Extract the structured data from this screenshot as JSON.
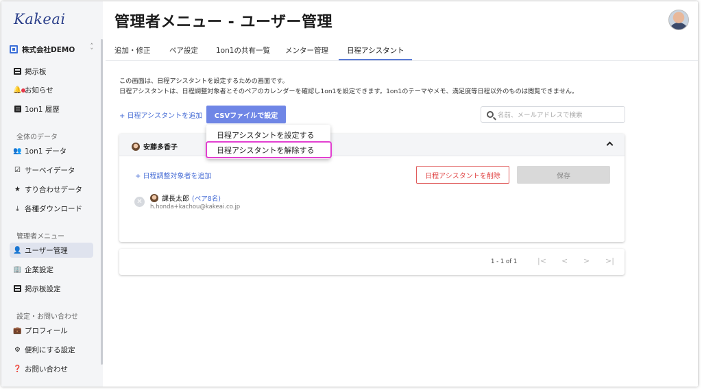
{
  "app": {
    "logo": "Kakeai"
  },
  "sidebar": {
    "company": "株式会社DEMO",
    "items_top": [
      {
        "label": "掲示板",
        "icon": "board-icon"
      },
      {
        "label": "お知らせ",
        "icon": "bell-icon"
      },
      {
        "label": "1on1 履歴",
        "icon": "history-icon"
      }
    ],
    "section_data": "全体のデータ",
    "items_data": [
      {
        "label": "1on1 データ",
        "icon": "people-icon"
      },
      {
        "label": "サーベイデータ",
        "icon": "survey-icon"
      },
      {
        "label": "すり合わせデータ",
        "icon": "star-icon"
      },
      {
        "label": "各種ダウンロード",
        "icon": "download-icon"
      }
    ],
    "section_admin": "管理者メニュー",
    "items_admin": [
      {
        "label": "ユーザー管理",
        "icon": "user-manage-icon",
        "active": true
      },
      {
        "label": "企業設定",
        "icon": "company-icon"
      },
      {
        "label": "掲示板設定",
        "icon": "board-settings-icon"
      }
    ],
    "section_settings": "設定・お問い合わせ",
    "items_settings": [
      {
        "label": "プロフィール",
        "icon": "profile-icon"
      },
      {
        "label": "便利にする設定",
        "icon": "gear-icon"
      },
      {
        "label": "お問い合わせ",
        "icon": "help-icon"
      }
    ]
  },
  "header": {
    "title": "管理者メニュー - ユーザー管理"
  },
  "tabs": [
    {
      "label": "追加・修正"
    },
    {
      "label": "ペア設定"
    },
    {
      "label": "1on1の共有一覧"
    },
    {
      "label": "メンター管理"
    },
    {
      "label": "日程アシスタント",
      "active": true
    }
  ],
  "description": {
    "line1": "この画面は、日程アシスタントを設定するための画面です。",
    "line2": "日程アシスタントは、日程調整対象者とそのペアのカレンダーを確認し1on1を設定できます。1on1のテーマやメモ、満足度等日程以外のものは閲覧できません。"
  },
  "toolbar": {
    "add_link": "+ 日程アシスタントを追加",
    "csv_button": "CSVファイルで設定",
    "search_placeholder": "名前、メールアドレスで検索"
  },
  "dropdown": {
    "items": [
      "日程アシスタントを設定する",
      "日程アシスタントを解除する"
    ]
  },
  "card": {
    "assistant_name": "安藤多香子",
    "add_target": "+ 日程調整対象者を追加",
    "delete_button": "日程アシスタントを削除",
    "save_button": "保存",
    "member": {
      "name": "課長太郎",
      "pair": "(ペア8名)",
      "email": "h.honda+kachou@kakeai.co.jp"
    }
  },
  "pagination": {
    "range": "1 - 1 of 1",
    "first": "|<",
    "prev": "<",
    "next": ">",
    "last": ">|"
  }
}
